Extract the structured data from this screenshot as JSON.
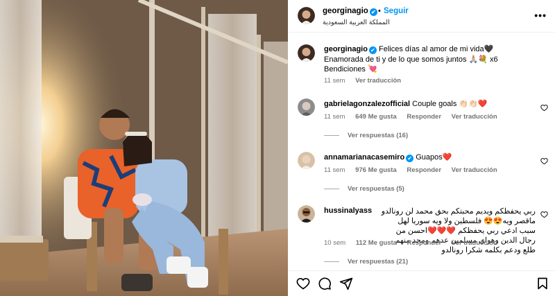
{
  "post": {
    "photo_alt": "Couple sitting on a chair on a terrace at sunset"
  },
  "header": {
    "username": "georginagio",
    "verified": "✔",
    "separator": "•",
    "follow_label": "Seguir",
    "location": "المملكة العربية السعودية",
    "more_icon": "more-horizontal-icon",
    "more_glyph": "⋮"
  },
  "caption": {
    "username": "georginagio",
    "text": "Felices días al amor de mi vida🖤 Enamorada de ti y de lo que somos juntos 🙏🏼💐 x6 Bendiciones 💘",
    "time": "11 sem",
    "translate": "Ver traducción"
  },
  "comments": [
    {
      "username": "gabrielagonzalezofficial",
      "text": "Couple goals 👏🏻👏🏻❤️",
      "time": "11 sem",
      "likes": "649 Me gusta",
      "reply": "Responder",
      "translate": "Ver traducción",
      "replies": "Ver respuestas (16)"
    },
    {
      "username": "annamarianacasemiro",
      "text": "Guapos❤️",
      "time": "11 sem",
      "likes": "976 Me gusta",
      "reply": "Responder",
      "translate": "Ver traducción",
      "replies": "Ver respuestas (5)"
    },
    {
      "username": "hussinalyass",
      "text": "ربي يحفظكم ويديم محبتكم بحق محمد لن رونالدو ماقصر ويه😍😍 فلسطين ولا ويه سوريا لهل سبب ادعي ربي يحفظكم ❤️❤️❤️احسن من رجال الدين وهواي مسلمين عدهم ومحد منهم طلع ودعم بكلمه شكرا رونالدو",
      "time": "10 sem",
      "likes": "112 Me gusta",
      "reply": "Responder",
      "translate": "Ver traducción",
      "replies": "Ver respuestas (21)"
    }
  ],
  "actions": {
    "like_icon": "heart-icon",
    "comment_icon": "comment-icon",
    "share_icon": "share-icon",
    "save_icon": "bookmark-icon"
  },
  "colors": {
    "accent": "#0095f6",
    "muted": "#737373"
  }
}
